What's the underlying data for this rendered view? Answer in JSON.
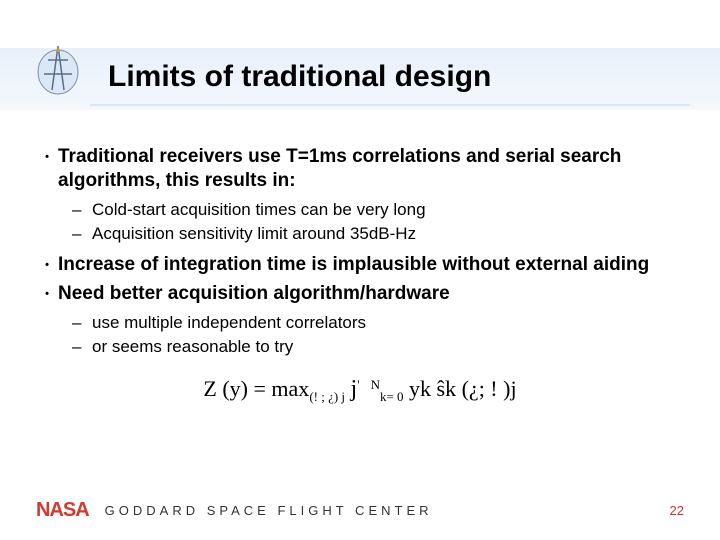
{
  "title": "Limits of traditional design",
  "bullets": [
    {
      "level": 1,
      "text": "Traditional receivers use T=1ms correlations and serial search algorithms, this results in:"
    },
    {
      "level": 2,
      "text": "Cold-start acquisition times can be very long"
    },
    {
      "level": 2,
      "text": "Acquisition sensitivity limit around 35dB-Hz"
    },
    {
      "level": 1,
      "text": "Increase of integration time is implausible without external aiding"
    },
    {
      "level": 1,
      "text": "Need better acquisition algorithm/hardware"
    },
    {
      "level": 2,
      "text": "use multiple independent correlators"
    },
    {
      "level": 2,
      "text": "or seems reasonable to try"
    }
  ],
  "equation": {
    "lhs": "Z (y) = ",
    "op": "max",
    "opsub": "(! ; ¿) j",
    "bigsup": "'",
    "sum_upper": "N",
    "sum_lower": "k= 0",
    "rhs": " yk ŝk (¿; ! )j"
  },
  "footer": {
    "brand": "NASA",
    "text": "GODDARD SPACE FLIGHT CENTER",
    "page": "22"
  }
}
